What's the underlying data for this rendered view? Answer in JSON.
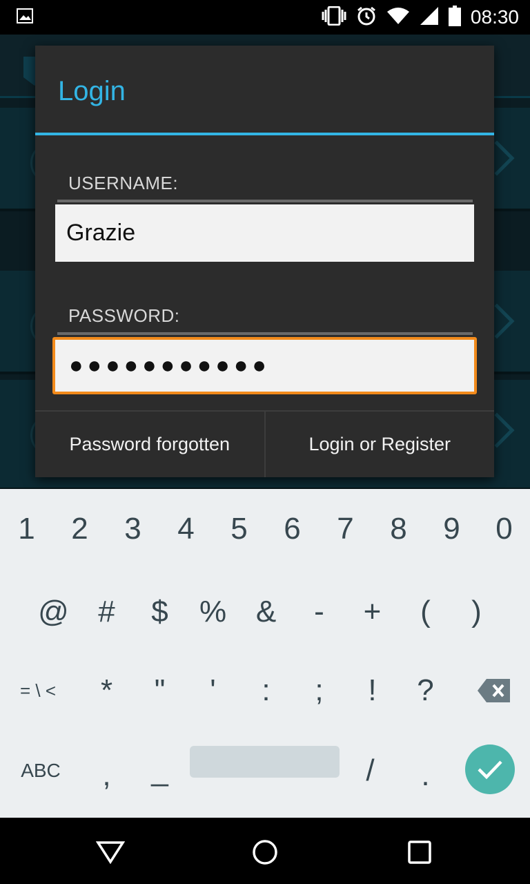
{
  "status_bar": {
    "time": "08:30",
    "icons": [
      "image-notification-icon",
      "vibrate-icon",
      "alarm-icon",
      "wifi-icon",
      "cell-signal-icon",
      "battery-icon"
    ]
  },
  "dialog": {
    "title": "Login",
    "username": {
      "label": "USERNAME:",
      "value": "Grazie"
    },
    "password": {
      "label": "PASSWORD:",
      "value": "●●●●●●●●●●●"
    },
    "buttons": {
      "left": "Password forgotten",
      "right": "Login or Register"
    }
  },
  "keyboard": {
    "row1": [
      "1",
      "2",
      "3",
      "4",
      "5",
      "6",
      "7",
      "8",
      "9",
      "0"
    ],
    "row2": [
      "@",
      "#",
      "$",
      "%",
      "&",
      "-",
      "+",
      "(",
      ")"
    ],
    "row3": [
      "= \\ <",
      "*",
      "\"",
      "'",
      ":",
      ";",
      "!",
      "?"
    ],
    "row4": {
      "abc": "ABC",
      "comma": ",",
      "underscore": "_",
      "slash": "/",
      "period": "."
    }
  },
  "colors": {
    "accent": "#33b5e5",
    "focus": "#f28a1b",
    "enter": "#4db6ac"
  }
}
